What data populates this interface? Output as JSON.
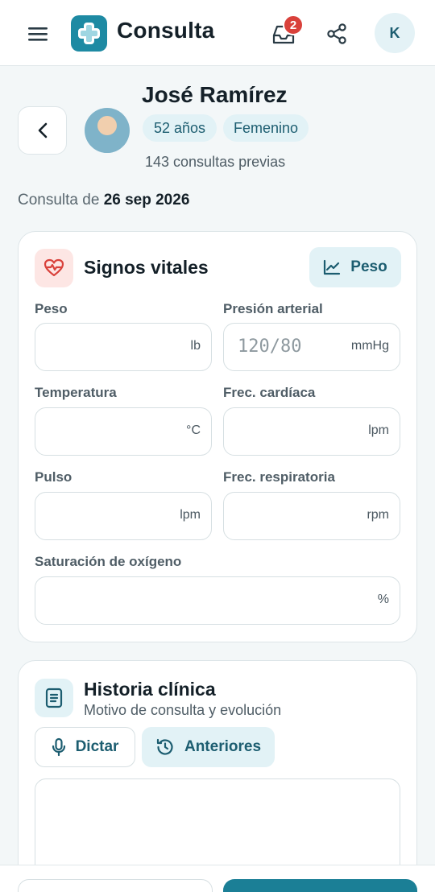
{
  "header": {
    "app_title": "Consulta",
    "notification_count": "2",
    "user_initial": "K",
    "icons": {
      "menu": "menu-icon",
      "logo": "medical-logo-icon",
      "inbox": "inbox-icon",
      "share": "share-icon"
    }
  },
  "patient": {
    "name": "José Ramírez",
    "age": "52 años",
    "sex": "Femenino",
    "previous_consults": "143 consultas previas"
  },
  "consult": {
    "date_prefix": "Consulta de",
    "date": "26 sep 2026"
  },
  "vitals": {
    "title": "Signos vitales",
    "chart_button": "Peso",
    "fields": {
      "weight": {
        "label": "Peso",
        "value": "",
        "unit": "lb"
      },
      "blood_pressure": {
        "label": "Presión arterial",
        "value": "",
        "placeholder": "120/80",
        "unit": "mmHg"
      },
      "temperature": {
        "label": "Temperatura",
        "value": "",
        "unit": "°C"
      },
      "heart_rate": {
        "label": "Frec. cardíaca",
        "value": "",
        "unit": "lpm"
      },
      "pulse": {
        "label": "Pulso",
        "value": "",
        "unit": "lpm"
      },
      "respiratory_rate": {
        "label": "Frec. respiratoria",
        "value": "",
        "unit": "rpm"
      },
      "oxygen_saturation": {
        "label": "Saturación de oxígeno",
        "value": "",
        "unit": "%"
      }
    }
  },
  "history": {
    "title": "Historia clínica",
    "subtitle": "Motivo de consulta y evolución",
    "dictate_button": "Dictar",
    "previous_button": "Anteriores",
    "notes": ""
  },
  "colors": {
    "accent": "#1b7f96",
    "chip_bg": "#e2f2f6",
    "badge": "#d9413b",
    "heart_bg": "#fde6e4",
    "heart": "#d9413b"
  }
}
